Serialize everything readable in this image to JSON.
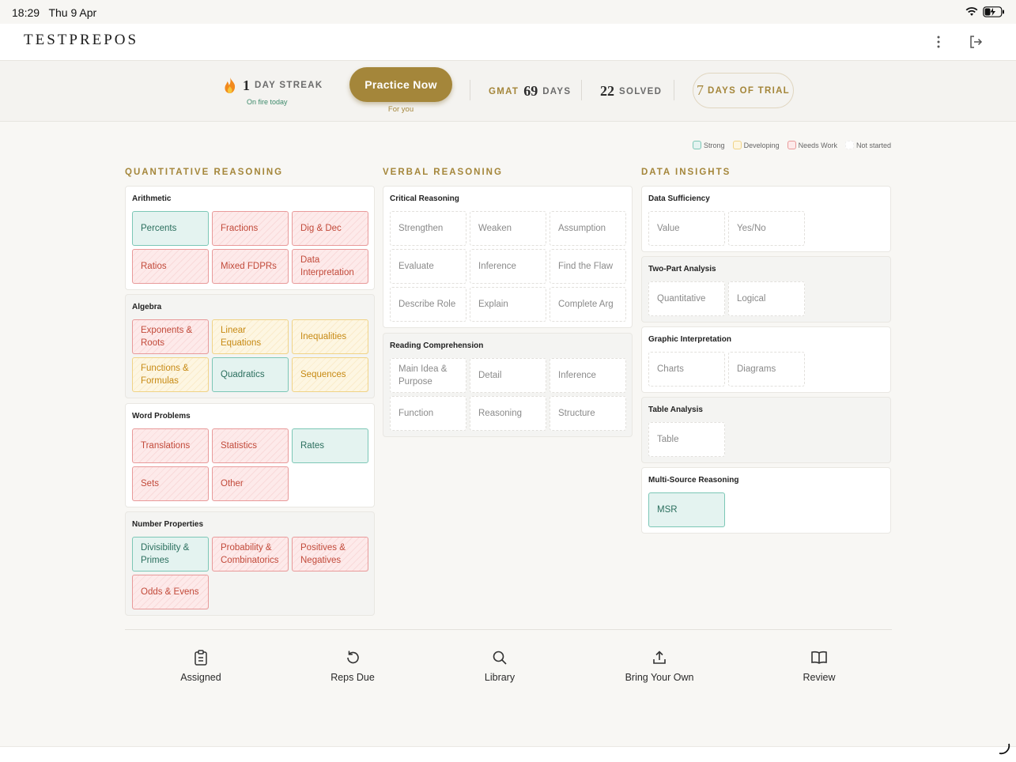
{
  "status": {
    "time": "18:29",
    "date": "Thu 9 Apr"
  },
  "header": {
    "logo": "TESTPREPOS"
  },
  "stats": {
    "streak_num": "1",
    "streak_label": "DAY STREAK",
    "streak_sub": "On fire today",
    "practice_label": "Practice Now",
    "practice_sub": "For you",
    "gmat_label": "GMAT",
    "gmat_num": "69",
    "gmat_days": "DAYS",
    "solved_num": "22",
    "solved_label": "SOLVED",
    "trial_num": "7",
    "trial_label": "DAYS OF TRIAL"
  },
  "legend": {
    "strong": "Strong",
    "developing": "Developing",
    "needs_work": "Needs Work",
    "not_started": "Not started"
  },
  "columns": {
    "quant": "QUANTITATIVE REASONING",
    "verbal": "VERBAL REASONING",
    "data": "DATA INSIGHTS"
  },
  "quant": {
    "arithmetic": {
      "title": "Arithmetic",
      "tiles": [
        "Percents",
        "Fractions",
        "Dig & Dec",
        "Ratios",
        "Mixed FDPRs",
        "Data Interpretation"
      ]
    },
    "algebra": {
      "title": "Algebra",
      "tiles": [
        "Exponents & Roots",
        "Linear Equations",
        "Inequalities",
        "Functions & Formulas",
        "Quadratics",
        "Sequences"
      ]
    },
    "word": {
      "title": "Word Problems",
      "tiles": [
        "Translations",
        "Statistics",
        "Rates",
        "Sets",
        "Other"
      ]
    },
    "number": {
      "title": "Number Properties",
      "tiles": [
        "Divisibility & Primes",
        "Probability & Combinatorics",
        "Positives & Negatives",
        "Odds & Evens"
      ]
    }
  },
  "verbal": {
    "critical": {
      "title": "Critical Reasoning",
      "tiles": [
        "Strengthen",
        "Weaken",
        "Assumption",
        "Evaluate",
        "Inference",
        "Find the Flaw",
        "Describe Role",
        "Explain",
        "Complete Arg"
      ]
    },
    "reading": {
      "title": "Reading Comprehension",
      "tiles": [
        "Main Idea & Purpose",
        "Detail",
        "Inference",
        "Function",
        "Reasoning",
        "Structure"
      ]
    }
  },
  "data_insights": {
    "ds": {
      "title": "Data Sufficiency",
      "tiles": [
        "Value",
        "Yes/No"
      ]
    },
    "tpa": {
      "title": "Two-Part Analysis",
      "tiles": [
        "Quantitative",
        "Logical"
      ]
    },
    "gi": {
      "title": "Graphic Interpretation",
      "tiles": [
        "Charts",
        "Diagrams"
      ]
    },
    "ta": {
      "title": "Table Analysis",
      "tiles": [
        "Table"
      ]
    },
    "msr": {
      "title": "Multi-Source Reasoning",
      "tiles": [
        "MSR"
      ]
    }
  },
  "nav": {
    "assigned": "Assigned",
    "reps_due": "Reps Due",
    "library": "Library",
    "byo": "Bring Your Own",
    "review": "Review"
  },
  "colors": {
    "accent": "#a4863a",
    "strong": "#7cc7b6",
    "developing": "#f0d387",
    "needs_work": "#e89a9a"
  }
}
